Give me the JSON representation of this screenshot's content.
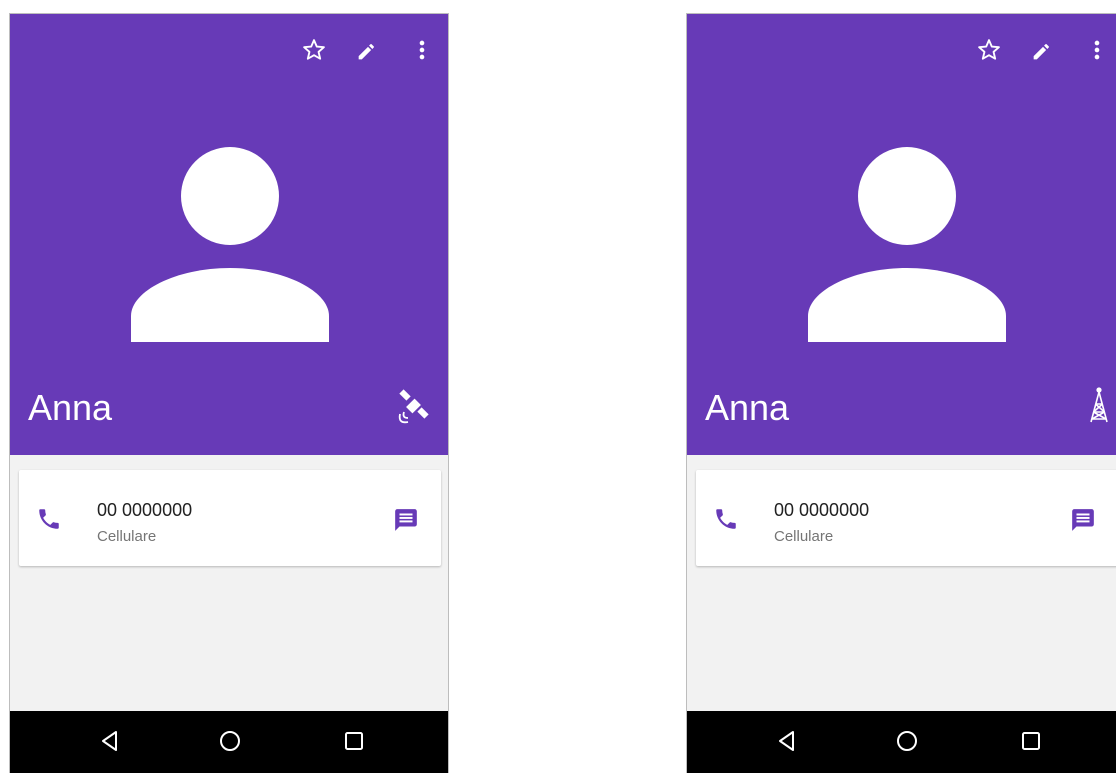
{
  "colors": {
    "primary": "#673ab7",
    "background": "#f2f2f2",
    "navbar": "#000000",
    "icon_accent": "#673ab7"
  },
  "screens": [
    {
      "contact": {
        "name": "Anna",
        "account_badge_icon": "satellite-icon"
      },
      "phone_entry": {
        "number": "00 0000000",
        "type": "Cellulare"
      },
      "toolbar_icons": [
        "star-outline-icon",
        "edit-pencil-icon",
        "more-vert-icon"
      ],
      "nav_icons": [
        "back-triangle-icon",
        "home-circle-icon",
        "recents-square-icon"
      ]
    },
    {
      "contact": {
        "name": "Anna",
        "account_badge_icon": "radio-tower-icon"
      },
      "phone_entry": {
        "number": "00 0000000",
        "type": "Cellulare"
      },
      "toolbar_icons": [
        "star-outline-icon",
        "edit-pencil-icon",
        "more-vert-icon"
      ],
      "nav_icons": [
        "back-triangle-icon",
        "home-circle-icon",
        "recents-square-icon"
      ]
    }
  ]
}
